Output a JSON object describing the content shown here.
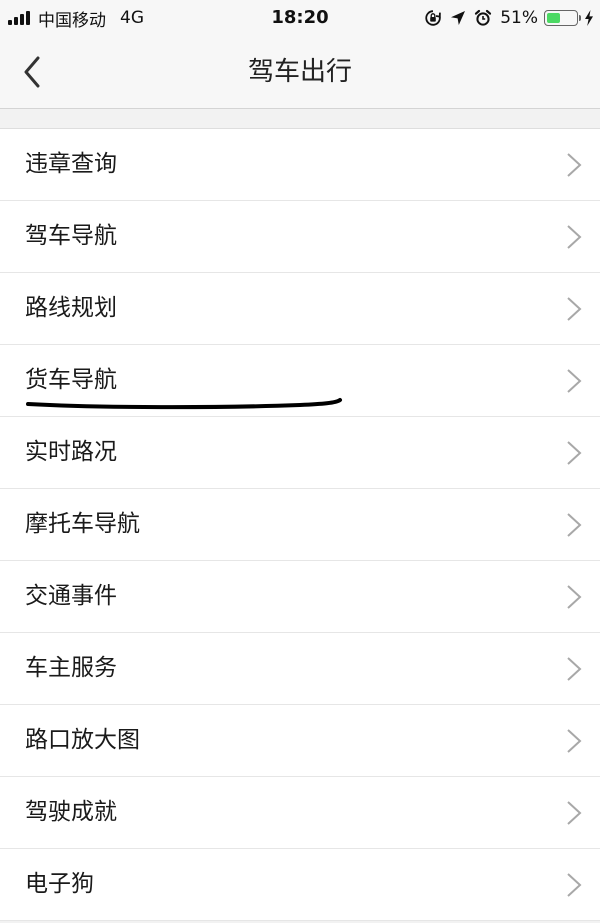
{
  "status_bar": {
    "carrier": "中国移动",
    "network": "4G",
    "time": "18:20",
    "battery_percent_label": "51%",
    "battery_level": 0.51,
    "battery_color": "#4cd964",
    "icons": [
      "signal-icon",
      "orientation-lock-icon",
      "location-arrow-icon",
      "alarm-icon",
      "battery-icon",
      "charging-bolt-icon"
    ]
  },
  "nav": {
    "title": "驾车出行",
    "back_icon": "chevron-left-icon"
  },
  "menu": {
    "items": [
      {
        "label": "违章查询"
      },
      {
        "label": "驾车导航"
      },
      {
        "label": "路线规划"
      },
      {
        "label": "货车导航"
      },
      {
        "label": "实时路况"
      },
      {
        "label": "摩托车导航"
      },
      {
        "label": "交通事件"
      },
      {
        "label": "车主服务"
      },
      {
        "label": "路口放大图"
      },
      {
        "label": "驾驶成就"
      },
      {
        "label": "电子狗"
      }
    ],
    "item_icon": "chevron-right-icon"
  },
  "annotation": {
    "type": "handwritten-underline",
    "target_item": "货车导航",
    "color": "#000000"
  }
}
